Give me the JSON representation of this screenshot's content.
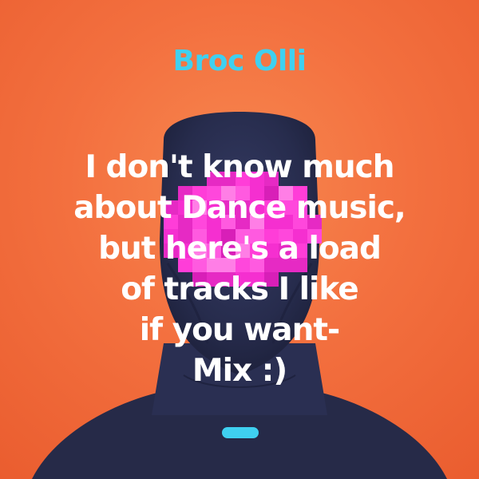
{
  "cover": {
    "artist": "Broc Olli",
    "caption_lines": [
      "I don't know much",
      "about Dance music,",
      "but here's a load",
      "of tracks I like",
      "if you want-",
      "Mix :)"
    ],
    "image_description": "person-in-dark-balaclava-with-pixelated-pink-face",
    "colors": {
      "background": "#f26d3d",
      "artist_text": "#3fd0f0",
      "caption_text": "#ffffff",
      "accent_pill": "#3fd0f0",
      "balaclava": "#2a2f52",
      "pixel_mask": "#ff3dd8"
    }
  }
}
